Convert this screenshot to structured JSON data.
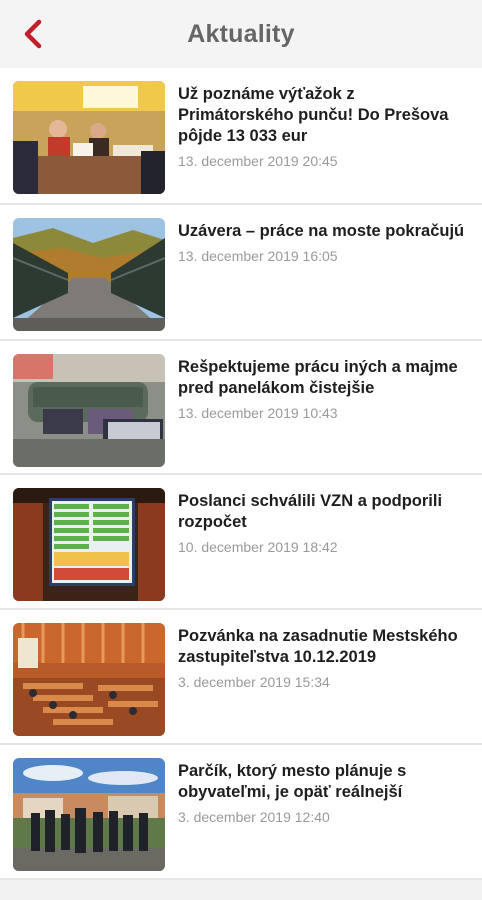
{
  "header": {
    "title": "Aktuality"
  },
  "colors": {
    "accent": "#c0202a"
  },
  "articles": [
    {
      "title": "Už poznáme výťažok z Primátorského punču! Do Prešova pôjde 13 033 eur",
      "date": "13. december 2019 20:45",
      "image": "christmas-market-stand"
    },
    {
      "title": "Uzávera – práce na moste pokračujú",
      "date": "13. december 2019 16:05",
      "image": "bridge-autumn"
    },
    {
      "title": "Rešpektujeme prácu iných a majme pred panelákom čistejšie",
      "date": "13. december 2019 10:43",
      "image": "waste-containers"
    },
    {
      "title": "Poslanci schválili VZN a podporili rozpočet",
      "date": "10. december 2019 18:42",
      "image": "voting-screen"
    },
    {
      "title": "Pozvánka na zasadnutie Mestského zastupiteľstva 10.12.2019",
      "date": "3. december 2019 15:34",
      "image": "council-hall"
    },
    {
      "title": "Parčík, ktorý mesto plánuje s obyvateľmi, je opäť reálnejší",
      "date": "3. december 2019 12:40",
      "image": "people-in-park"
    }
  ]
}
